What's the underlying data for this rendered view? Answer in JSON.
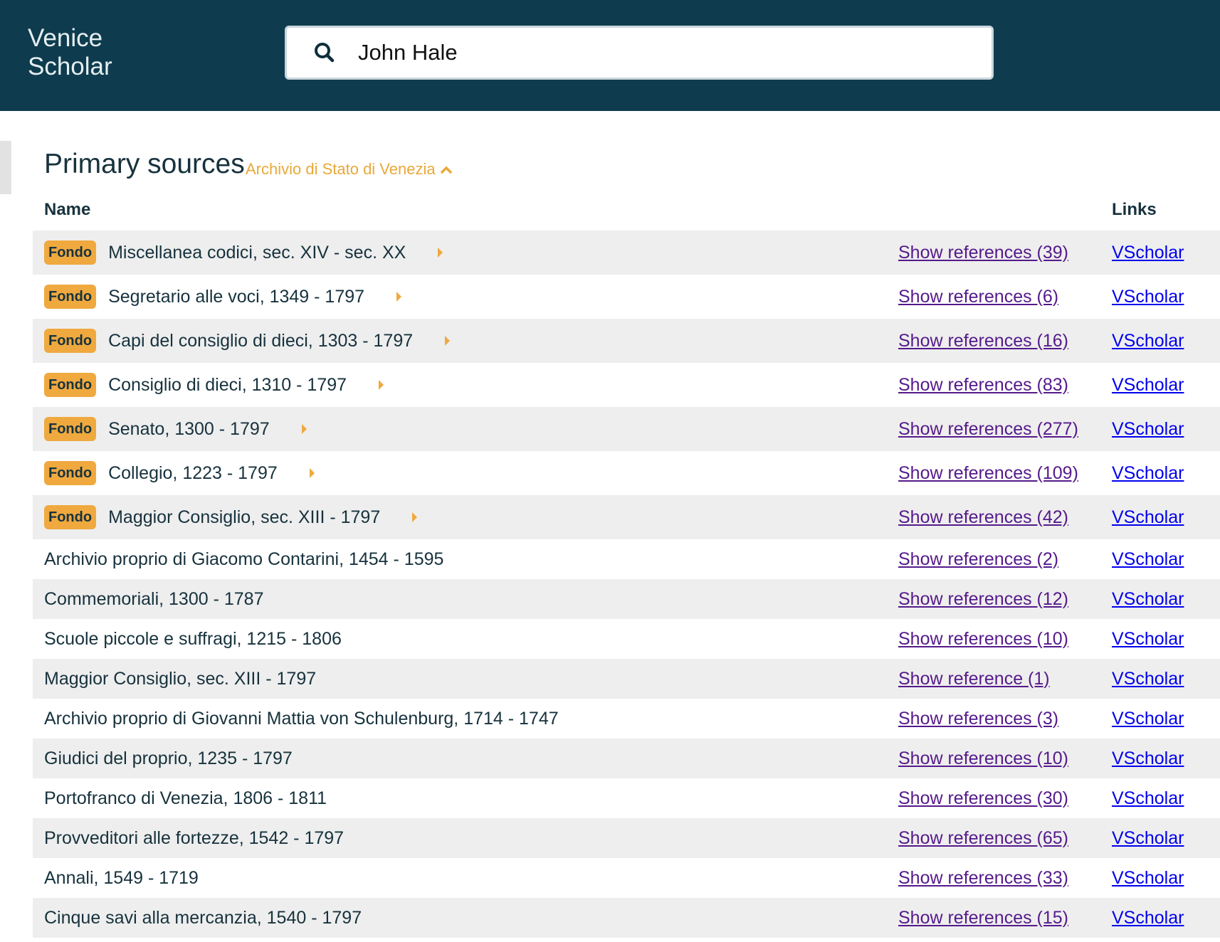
{
  "brand": {
    "line1": "Venice",
    "line2": "Scholar"
  },
  "search": {
    "value": "John Hale",
    "icon": "search-icon"
  },
  "section": {
    "title": "Primary sources",
    "archive": "Archivio di Stato di Venezia"
  },
  "columns": {
    "name": "Name",
    "links": "Links"
  },
  "colors": {
    "header_bg": "#0e3c4e",
    "badge": "#efa93f",
    "visited_link": "#551a8b",
    "link": "#0000ee",
    "row_shade": "#eeeeee"
  },
  "rows": [
    {
      "badge": "Fondo",
      "name": "Miscellanea codici, sec. XIV - sec. XX",
      "ref": "Show references (39)",
      "link": "VScholar"
    },
    {
      "badge": "Fondo",
      "name": "Segretario alle voci, 1349 - 1797",
      "ref": "Show references (6)",
      "link": "VScholar"
    },
    {
      "badge": "Fondo",
      "name": "Capi del consiglio di dieci, 1303 - 1797",
      "ref": "Show references (16)",
      "link": "VScholar"
    },
    {
      "badge": "Fondo",
      "name": "Consiglio di dieci, 1310 - 1797",
      "ref": "Show references (83)",
      "link": "VScholar"
    },
    {
      "badge": "Fondo",
      "name": "Senato, 1300 - 1797",
      "ref": "Show references (277)",
      "link": "VScholar"
    },
    {
      "badge": "Fondo",
      "name": "Collegio, 1223 - 1797",
      "ref": "Show references (109)",
      "link": "VScholar"
    },
    {
      "badge": "Fondo",
      "name": "Maggior Consiglio, sec. XIII - 1797",
      "ref": "Show references (42)",
      "link": "VScholar"
    },
    {
      "name": "Archivio proprio di Giacomo Contarini, 1454 - 1595",
      "ref": "Show references (2)",
      "link": "VScholar"
    },
    {
      "name": "Commemoriali, 1300 - 1787",
      "ref": "Show references (12)",
      "link": "VScholar"
    },
    {
      "name": "Scuole piccole e suffragi, 1215 - 1806",
      "ref": "Show references (10)",
      "link": "VScholar"
    },
    {
      "name": "Maggior Consiglio, sec. XIII - 1797",
      "ref": "Show reference (1)",
      "link": "VScholar"
    },
    {
      "name": "Archivio proprio di Giovanni Mattia von Schulenburg, 1714 - 1747",
      "ref": "Show references (3)",
      "link": "VScholar"
    },
    {
      "name": "Giudici del proprio, 1235 - 1797",
      "ref": "Show references (10)",
      "link": "VScholar"
    },
    {
      "name": "Portofranco di Venezia, 1806 - 1811",
      "ref": "Show references (30)",
      "link": "VScholar"
    },
    {
      "name": "Provveditori alle fortezze, 1542 - 1797",
      "ref": "Show references (65)",
      "link": "VScholar"
    },
    {
      "name": "Annali, 1549 - 1719",
      "ref": "Show references (33)",
      "link": "VScholar"
    },
    {
      "name": "Cinque savi alla mercanzia, 1540 - 1797",
      "ref": "Show references (15)",
      "link": "VScholar"
    }
  ]
}
